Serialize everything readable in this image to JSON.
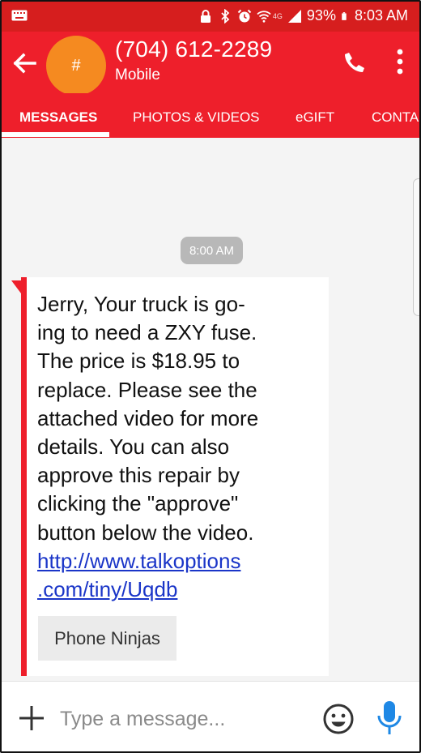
{
  "status_bar": {
    "battery_percent": "93%",
    "time": "8:03 AM",
    "network": "4G"
  },
  "header": {
    "avatar_initial": "#",
    "title": "(704) 612-2289",
    "subtitle": "Mobile"
  },
  "tabs": [
    {
      "label": "MESSAGES",
      "active": true
    },
    {
      "label": "PHOTOS & VIDEOS",
      "active": false
    },
    {
      "label": "eGIFT",
      "active": false
    },
    {
      "label": "CONTACT",
      "active": false
    }
  ],
  "conversation": {
    "timestamp": "8:00 AM",
    "message": {
      "lines": [
        "Jerry, Your truck is go-",
        "ing to need a ZXY fuse.",
        "The price is $18.95 to",
        "replace. Please see the",
        "attached video for more",
        "details. You can also",
        "approve this repair by",
        "clicking the \"approve\"",
        "button below the video."
      ],
      "link_line_1": "http://www.talkoptions",
      "link_line_2": ".com/tiny/Uqdb",
      "sender_chip": "Phone Ninjas"
    }
  },
  "compose": {
    "placeholder": "Type a message..."
  },
  "colors": {
    "brand_red": "#ee1f2b",
    "status_red": "#d61e1e",
    "avatar_orange": "#f58a20",
    "link_blue": "#1a35c8",
    "mic_blue": "#1e88e5"
  }
}
